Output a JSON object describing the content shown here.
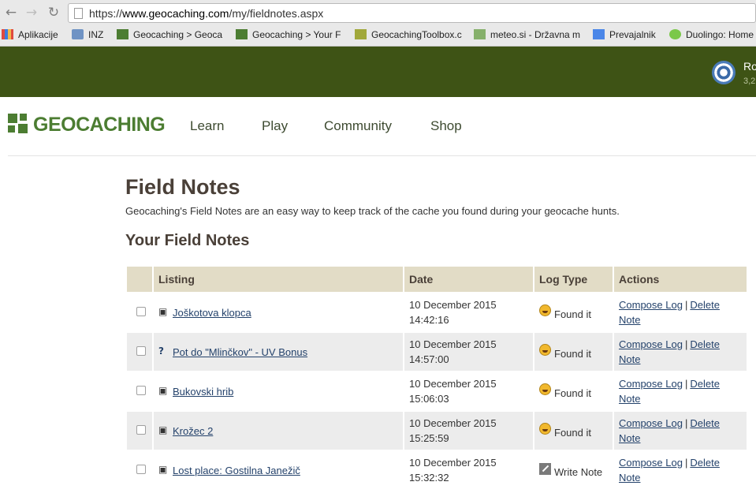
{
  "browser": {
    "url_prefix": "https://",
    "url_domain": "www.geocaching.com",
    "url_path": "/my/fieldnotes.aspx",
    "bookmarks": [
      {
        "label": "Aplikacije",
        "icon": "apps-icon"
      },
      {
        "label": "INZ",
        "icon": "folder-icon"
      },
      {
        "label": "Geocaching > Geoca",
        "icon": "geocaching-favicon"
      },
      {
        "label": "Geocaching > Your F",
        "icon": "geocaching-favicon"
      },
      {
        "label": "GeocachingToolbox.c",
        "icon": "toolbox-favicon"
      },
      {
        "label": "meteo.si - Državna m",
        "icon": "meteo-favicon"
      },
      {
        "label": "Prevajalnik",
        "icon": "translate-icon"
      },
      {
        "label": "Duolingo: Home",
        "icon": "duolingo-icon"
      }
    ]
  },
  "header": {
    "user_name": "Ro",
    "user_stat": "3,2",
    "logo_text": "GEOCACHING",
    "nav": [
      "Learn",
      "Play",
      "Community",
      "Shop"
    ]
  },
  "page": {
    "title": "Field Notes",
    "description": "Geocaching's Field Notes are an easy way to keep track of the cache you found during your geocache hunts.",
    "section_title": "Your Field Notes"
  },
  "table": {
    "columns": [
      "Listing",
      "Date",
      "Log Type",
      "Actions"
    ],
    "rows": [
      {
        "icon": "traditional-cache-icon",
        "listing": "Joškotova klopca",
        "date": "10 December 2015",
        "time": "14:42:16",
        "log_icon": "found-it-smiley-icon",
        "log_type": "Found it"
      },
      {
        "icon": "mystery-cache-icon",
        "listing": "Pot do \"Mlinčkov\" - UV Bonus",
        "date": "10 December 2015",
        "time": "14:57:00",
        "log_icon": "found-it-smiley-icon",
        "log_type": "Found it"
      },
      {
        "icon": "traditional-cache-icon",
        "listing": "Bukovski hrib",
        "date": "10 December 2015",
        "time": "15:06:03",
        "log_icon": "found-it-smiley-icon",
        "log_type": "Found it"
      },
      {
        "icon": "traditional-cache-icon",
        "listing": "Krožec 2",
        "date": "10 December 2015",
        "time": "15:25:59",
        "log_icon": "found-it-smiley-icon",
        "log_type": "Found it"
      },
      {
        "icon": "traditional-cache-icon",
        "listing": "Lost place: Gostilna Janežič",
        "date": "10 December 2015",
        "time": "15:32:32",
        "log_icon": "write-note-icon",
        "log_type": "Write Note"
      }
    ],
    "action_compose": "Compose Log",
    "action_separator": "|",
    "action_delete_1": "Delete",
    "action_delete_2": "Note"
  },
  "colors": {
    "topbar": "#3e5315",
    "brand_green": "#4c7d32",
    "table_header": "#e2dcc6",
    "link": "#24426b"
  }
}
